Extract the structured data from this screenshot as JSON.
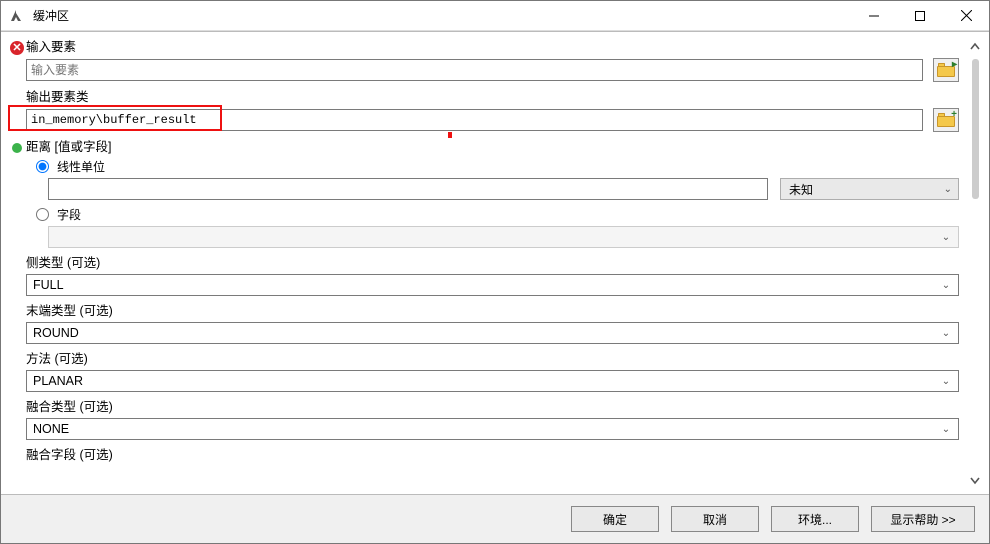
{
  "window": {
    "title": "缓冲区"
  },
  "fields": {
    "input_features": {
      "label": "输入要素",
      "placeholder": "输入要素",
      "value": ""
    },
    "output_fc": {
      "label": "输出要素类",
      "value": "in_memory\\buffer_result"
    },
    "distance": {
      "label": "距离 [值或字段]"
    },
    "linear_unit": {
      "label": "线性单位",
      "value": "",
      "unit": "未知"
    },
    "field": {
      "label": "字段",
      "value": ""
    },
    "side_type": {
      "label": "侧类型 (可选)",
      "value": "FULL"
    },
    "end_type": {
      "label": "末端类型 (可选)",
      "value": "ROUND"
    },
    "method": {
      "label": "方法 (可选)",
      "value": "PLANAR"
    },
    "dissolve_type": {
      "label": "融合类型 (可选)",
      "value": "NONE"
    },
    "dissolve_field": {
      "label": "融合字段 (可选)"
    }
  },
  "buttons": {
    "ok": "确定",
    "cancel": "取消",
    "env": "环境...",
    "help": "显示帮助 >>"
  }
}
